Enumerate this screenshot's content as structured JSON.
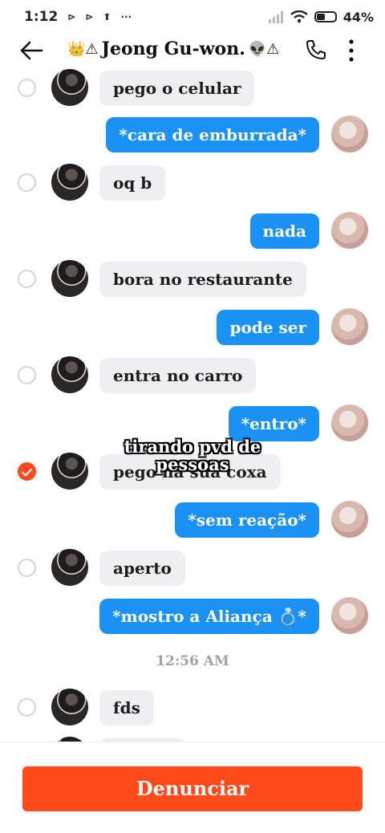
{
  "status_bar": {
    "time": "1:12",
    "glyphs": [
      "⊳",
      "⊳",
      "⬆",
      "···"
    ],
    "battery_text": "44%",
    "battery_level": 0.44
  },
  "header": {
    "title": "Jeong Gu-won.",
    "emoji_left": "👑⚠",
    "emoji_right": "👽⚠",
    "back_icon": "arrow-left-icon",
    "phone_icon": "phone-icon",
    "more_icon": "more-vertical-icon"
  },
  "messages": [
    {
      "side": "in",
      "text": "pego o celular",
      "selected": false
    },
    {
      "side": "out",
      "text": "*cara de emburrada*"
    },
    {
      "side": "in",
      "text": "oq b",
      "selected": false
    },
    {
      "side": "out",
      "text": "nada"
    },
    {
      "side": "in",
      "text": "bora no restaurante",
      "selected": false
    },
    {
      "side": "out",
      "text": "pode ser"
    },
    {
      "side": "in",
      "text": "entra no carro",
      "selected": false
    },
    {
      "side": "out",
      "text": "*entro*"
    },
    {
      "side": "in",
      "text": "pego na sua coxa",
      "selected": true
    },
    {
      "side": "out",
      "text": "*sem reação*"
    },
    {
      "side": "in",
      "text": "aperto",
      "selected": false
    },
    {
      "side": "out",
      "text": "*mostro a Aliança 💍*"
    },
    {
      "side": "in",
      "text": "fds",
      "selected": false
    }
  ],
  "timestamp": "12:56 AM",
  "overlay": {
    "line1": "tirando pvd de",
    "line2": "pessoas"
  },
  "report_button": "Denunciar",
  "colors": {
    "accent": "#ff4a1c",
    "bubble_out": "#1a91f5",
    "bubble_in": "#efeff1"
  }
}
